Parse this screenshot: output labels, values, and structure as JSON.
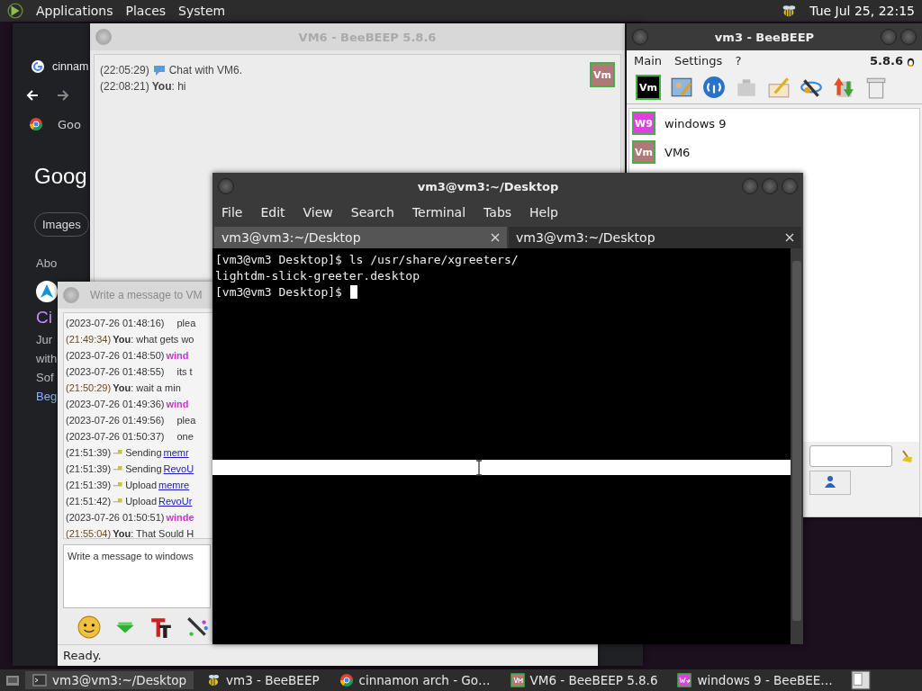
{
  "top_panel": {
    "menus": [
      "Applications",
      "Places",
      "System"
    ],
    "clock": "Tue Jul 25, 22:15"
  },
  "chrome_window": {
    "tab": "cinnam",
    "notice": "Goo",
    "logo": "Goog",
    "filters": [
      "Images"
    ],
    "side_texts": [
      {
        "text": "Abo",
        "kind": "plain"
      },
      {
        "text": "Ci",
        "kind": "title"
      },
      {
        "text": "Jur",
        "kind": "plain"
      },
      {
        "text": "with",
        "kind": "plain"
      },
      {
        "text": "Sof",
        "kind": "plain"
      },
      {
        "text": "Beg",
        "kind": "link"
      }
    ]
  },
  "vm6_window": {
    "title": "VM6 - BeeBEEP 5.8.6",
    "avatar": "Vm",
    "messages": [
      {
        "time": "(22:05:29)",
        "kind": "system",
        "text": "Chat with VM6."
      },
      {
        "time": "(22:08:21)",
        "kind": "mine",
        "text": "**You**: hi"
      }
    ]
  },
  "chat_window": {
    "title": "Write a message to VM",
    "placeholder": "Write a message to windows",
    "status": "Ready.",
    "messages": [
      {
        "time": "(2023-07-26 01:48:16)",
        "kind": "reply",
        "text": "plea"
      },
      {
        "time": "(21:49:34)",
        "kind": "mine",
        "text": "**You**: what gets wo"
      },
      {
        "time": "(2023-07-26 01:48:50)",
        "kind": "name",
        "text": "wind",
        "color": "#d030d0"
      },
      {
        "time": "(2023-07-26 01:48:55)",
        "kind": "reply",
        "text": "its t"
      },
      {
        "time": "(21:50:29)",
        "kind": "mine",
        "text": "**You**: wait a min"
      },
      {
        "time": "(2023-07-26 01:49:36)",
        "kind": "name",
        "text": "wind",
        "color": "#d030d0"
      },
      {
        "time": "(2023-07-26 01:49:56)",
        "kind": "reply",
        "text": "plea"
      },
      {
        "time": "(2023-07-26 01:50:37)",
        "kind": "reply",
        "text": "one"
      },
      {
        "time": "(21:51:39)",
        "kind": "file",
        "text": "Sending",
        "link": "memr"
      },
      {
        "time": "(21:51:39)",
        "kind": "file",
        "text": "Sending",
        "link": "RevoU"
      },
      {
        "time": "(21:51:39)",
        "kind": "file",
        "text": "Upload",
        "link": "memre"
      },
      {
        "time": "(21:51:42)",
        "kind": "file",
        "text": "Upload",
        "link": "RevoUr"
      },
      {
        "time": "(2023-07-26 01:50:51)",
        "kind": "name",
        "text": "winde",
        "color": "#d030d0"
      },
      {
        "time": "(21:55:04)",
        "kind": "mine",
        "text": "**You**: That Sould H"
      }
    ]
  },
  "vm3_window": {
    "title": "vm3 - BeeBEEP",
    "menus": [
      "Main",
      "Settings",
      "?"
    ],
    "version": "5.8.6",
    "toolbar_avatar": "Vm",
    "users": [
      {
        "name": "windows 9",
        "avatar": "W9",
        "color": "#e040e0"
      },
      {
        "name": "VM6",
        "avatar": "Vm",
        "color": "#b07878"
      }
    ]
  },
  "terminal": {
    "title": "vm3@vm3:~/Desktop",
    "menus": [
      "File",
      "Edit",
      "View",
      "Search",
      "Terminal",
      "Tabs",
      "Help"
    ],
    "tabs": [
      {
        "label": "vm3@vm3:~/Desktop",
        "selected": true
      },
      {
        "label": "vm3@vm3:~/Desktop",
        "selected": false
      }
    ],
    "lines": [
      "[vm3@vm3 Desktop]$ ls /usr/share/xgreeters/",
      "lightdm-slick-greeter.desktop",
      "[vm3@vm3 Desktop]$"
    ]
  },
  "taskbar": {
    "items": [
      {
        "label": "vm3@vm3:~/Desktop",
        "kind": "terminal",
        "selected": true
      },
      {
        "label": "vm3 - BeeBEEP",
        "kind": "bee",
        "selected": false
      },
      {
        "label": "cinnamon arch - Go…",
        "kind": "chrome",
        "selected": false
      },
      {
        "label": "VM6 - BeeBEEP 5.8.6",
        "kind": "vm",
        "selected": false
      },
      {
        "label": "windows 9 - BeeBEE…",
        "kind": "w9",
        "selected": false
      }
    ]
  }
}
